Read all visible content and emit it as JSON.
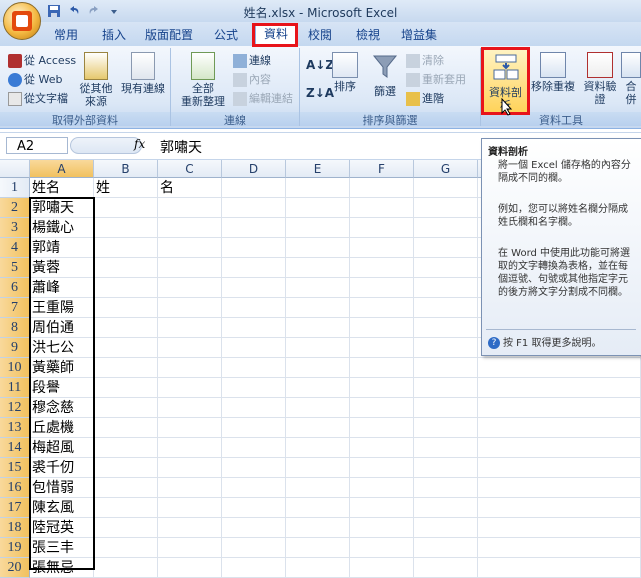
{
  "window": {
    "title": "姓名.xlsx - Microsoft Excel"
  },
  "ribbon_tabs": [
    "常用",
    "插入",
    "版面配置",
    "公式",
    "資料",
    "校閱",
    "檢視",
    "增益集"
  ],
  "active_tab": "資料",
  "ribbon": {
    "external": {
      "access": "從 Access",
      "web": "從 Web",
      "text": "從文字檔",
      "other_line1": "從其他",
      "other_line2": "來源",
      "existing": "現有連線",
      "label": "取得外部資料"
    },
    "connections": {
      "refresh_line1": "全部",
      "refresh_line2": "重新整理",
      "connections": "連線",
      "properties": "內容",
      "edit_links": "編輯連結",
      "label": "連線"
    },
    "sort_filter": {
      "sort": "排序",
      "filter": "篩選",
      "clear": "清除",
      "reapply": "重新套用",
      "advanced": "進階",
      "label": "排序與篩選"
    },
    "data_tools": {
      "text_to_columns": "資料剖析",
      "remove_duplicates": "移除重複",
      "validation": "資料驗證",
      "consolidate": "合併",
      "label": "資料工具"
    }
  },
  "formula_bar": {
    "name_box": "A2",
    "fx": "fx",
    "content": "郭嘯天"
  },
  "columns": [
    "A",
    "B",
    "C",
    "D",
    "E",
    "F",
    "G"
  ],
  "rows": [
    [
      "姓名",
      "姓",
      "名"
    ],
    [
      "郭嘯天",
      "",
      ""
    ],
    [
      "楊鐵心",
      "",
      ""
    ],
    [
      "郭靖",
      "",
      ""
    ],
    [
      "黃蓉",
      "",
      ""
    ],
    [
      "蕭峰",
      "",
      ""
    ],
    [
      "王重陽",
      "",
      ""
    ],
    [
      "周伯通",
      "",
      ""
    ],
    [
      "洪七公",
      "",
      ""
    ],
    [
      "黃藥師",
      "",
      ""
    ],
    [
      "段譽",
      "",
      ""
    ],
    [
      "穆念慈",
      "",
      ""
    ],
    [
      "丘處機",
      "",
      ""
    ],
    [
      "梅超風",
      "",
      ""
    ],
    [
      "裘千仞",
      "",
      ""
    ],
    [
      "包惜弱",
      "",
      ""
    ],
    [
      "陳玄風",
      "",
      ""
    ],
    [
      "陸冠英",
      "",
      ""
    ],
    [
      "張三丰",
      "",
      ""
    ],
    [
      "張無忌",
      "",
      ""
    ]
  ],
  "tooltip": {
    "title": "資料剖析",
    "p1": "將一個 Excel 儲存格的內容分隔成不同的欄。",
    "p2": "例如，您可以將姓名欄分隔成姓氏欄和名字欄。",
    "p3": "在 Word 中使用此功能可將選取的文字轉換為表格，並在每個逗號、句號或其他指定字元的後方將文字分割成不同欄。",
    "help": "按 F1 取得更多說明。"
  },
  "colors": {
    "highlight": "#e8141a",
    "ribbon": "#dbe7f6",
    "selected_header": "#f1c15f"
  }
}
